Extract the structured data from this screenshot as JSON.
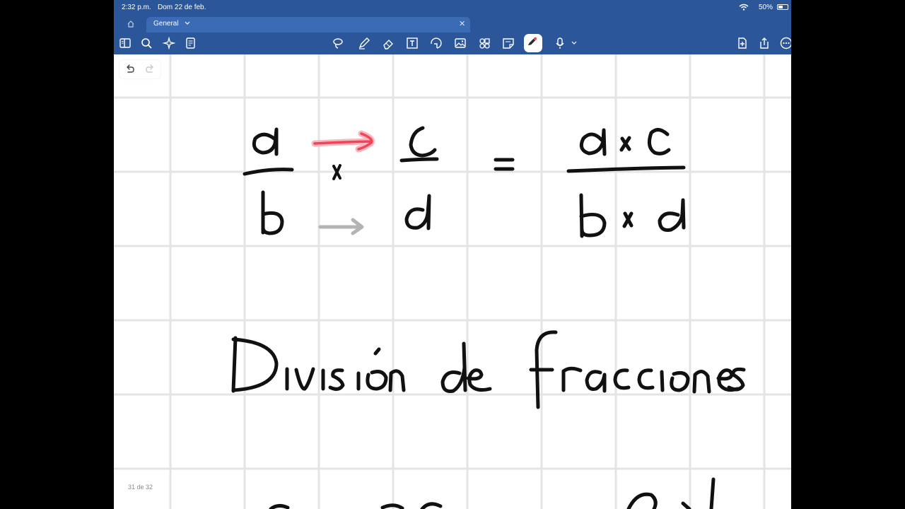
{
  "status_bar": {
    "time": "2:32 p.m.",
    "date": "Dom 22 de feb.",
    "battery": "50%"
  },
  "tabs": {
    "home_icon": "home-icon",
    "active": "General"
  },
  "toolbar": {
    "left_icons": [
      "sidebar-icon",
      "search-icon",
      "sparkle-icon",
      "page-list-icon"
    ],
    "center_icons": [
      "lasso-icon",
      "pen-icon",
      "eraser-icon",
      "text-box-icon",
      "shape-icon",
      "image-icon",
      "stickers-icon",
      "note-icon",
      "pen-color-icon",
      "microphone-icon"
    ],
    "right_icons": [
      "add-page-icon",
      "share-icon",
      "more-icon"
    ]
  },
  "colors": {
    "toolbar": "#2b579a",
    "tab_active": "#3c6bb6",
    "grid": "#e4e4e4",
    "ink": "#111111",
    "highlight_red": "#f0445a",
    "arrow_gray": "#b4b4b4"
  },
  "page": {
    "indicator": "31 de 32",
    "heading": "División de fracciones"
  }
}
